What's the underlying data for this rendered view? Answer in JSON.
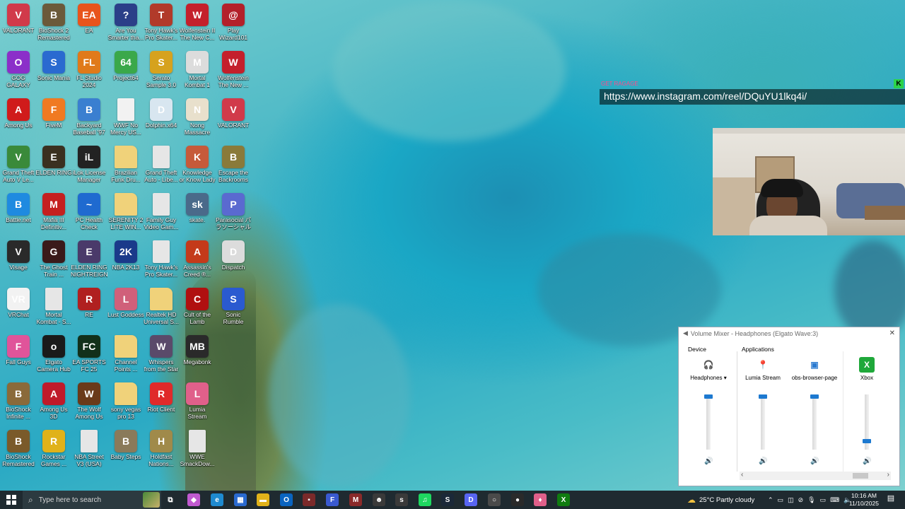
{
  "desktop_icons": [
    {
      "label": "VALORANT",
      "color": "#d13a4a",
      "glyph": "V",
      "icon": "valorant-icon"
    },
    {
      "label": "BioShock 2\nRemastered",
      "color": "#6b5a3a",
      "glyph": "B",
      "icon": "bioshock2-icon"
    },
    {
      "label": "EA",
      "color": "#e8541c",
      "glyph": "EA",
      "icon": "ea-icon"
    },
    {
      "label": "Are You\nSmarter tha...",
      "color": "#2b3f88",
      "glyph": "?",
      "icon": "are-you-smarter-icon"
    },
    {
      "label": "Tony Hawk's\nPro Skater...",
      "color": "#b13a2a",
      "glyph": "T",
      "icon": "tony-hawk-icon"
    },
    {
      "label": "Wolfenstein II\nThe New C...",
      "color": "#c4202c",
      "glyph": "W",
      "icon": "wolfenstein2-icon"
    },
    {
      "label": "Play\nWizard101",
      "color": "#b3202a",
      "glyph": "@",
      "icon": "wizard101-icon"
    },
    {
      "label": "GOG GALAXY",
      "color": "#8b2fc9",
      "glyph": "O",
      "icon": "gog-galaxy-icon"
    },
    {
      "label": "Sonic Mania",
      "color": "#2a6ad0",
      "glyph": "S",
      "icon": "sonic-mania-icon"
    },
    {
      "label": "FL Studio\n2024",
      "color": "#e07a1a",
      "glyph": "FL",
      "icon": "fl-studio-icon"
    },
    {
      "label": "Project64",
      "color": "#3aa84a",
      "glyph": "64",
      "icon": "project64-icon"
    },
    {
      "label": "Serato\nSample 3.0",
      "color": "#d6a21e",
      "glyph": "S",
      "icon": "serato-icon"
    },
    {
      "label": "Mortal\nKombat 1",
      "color": "#dcdcdc",
      "glyph": "M",
      "icon": "mortal-kombat1-icon"
    },
    {
      "label": "Wolfenstein\nThe New ...",
      "color": "#c4202c",
      "glyph": "W",
      "icon": "wolfenstein-icon"
    },
    {
      "label": "Among Us",
      "color": "#d01b1b",
      "glyph": "A",
      "icon": "among-us-icon"
    },
    {
      "label": "FiveM",
      "color": "#f07a22",
      "glyph": "F",
      "icon": "fivem-icon"
    },
    {
      "label": "Backyard\nBaseball '97",
      "color": "#3a7fd0",
      "glyph": "B",
      "icon": "backyard-baseball-icon"
    },
    {
      "label": "WWF No\nMercy US...",
      "color": "#f2f2f2",
      "glyph": "",
      "icon": "file-icon"
    },
    {
      "label": "Dolphin.x64",
      "color": "#d8e6f0",
      "glyph": "D",
      "icon": "dolphin-icon"
    },
    {
      "label": "Nong\nMassacre",
      "color": "#e8e0cc",
      "glyph": "N",
      "icon": "nong-massacre-icon"
    },
    {
      "label": "VALORANT",
      "color": "#d13a4a",
      "glyph": "V",
      "icon": "valorant-icon"
    },
    {
      "label": "Grand Theft\nAuto V Le...",
      "color": "#3a8a3a",
      "glyph": "V",
      "icon": "gta5-icon"
    },
    {
      "label": "ELDEN RING",
      "color": "#3a3020",
      "glyph": "E",
      "icon": "elden-ring-icon"
    },
    {
      "label": "iLok License\nManager",
      "color": "#222222",
      "glyph": "iL",
      "icon": "ilok-icon"
    },
    {
      "label": "Brazilian\nFunk Dru...",
      "color": "#f0d27a",
      "glyph": "",
      "icon": "folder-icon"
    },
    {
      "label": "Grand Theft\nAuto - Libe...",
      "color": "#e6e6e6",
      "glyph": "",
      "icon": "file-icon"
    },
    {
      "label": "Knowledge\nor Know Lady",
      "color": "#c65a3a",
      "glyph": "K",
      "icon": "knowledge-icon"
    },
    {
      "label": "Escape the\nBackrooms",
      "color": "#8a7a3a",
      "glyph": "B",
      "icon": "backrooms-icon"
    },
    {
      "label": "Battle.net",
      "color": "#1f8ae0",
      "glyph": "B",
      "icon": "battlenet-icon"
    },
    {
      "label": "Mafia III\nDefinitiv...",
      "color": "#c42020",
      "glyph": "M",
      "icon": "mafia3-icon"
    },
    {
      "label": "PC Health\nCheck",
      "color": "#1f6ad0",
      "glyph": "~",
      "icon": "pc-health-icon"
    },
    {
      "label": "SERENITY 2\nLITE WIN...",
      "color": "#f0d27a",
      "glyph": "",
      "icon": "folder-icon"
    },
    {
      "label": "Family Guy\nVideo Gam...",
      "color": "#e6e6e6",
      "glyph": "",
      "icon": "file-icon"
    },
    {
      "label": "skate.",
      "color": "#4a6a8a",
      "glyph": "sk",
      "icon": "skate-icon"
    },
    {
      "label": "Parasocial パ\nラソーシャル",
      "color": "#5a6ad0",
      "glyph": "P",
      "icon": "parasocial-icon"
    },
    {
      "label": "Visage",
      "color": "#2a2a2a",
      "glyph": "V",
      "icon": "visage-icon"
    },
    {
      "label": "The Ghost\nTrain ...",
      "color": "#3a1a1a",
      "glyph": "G",
      "icon": "ghost-train-icon"
    },
    {
      "label": "ELDEN RING\nNIGHTREIGN",
      "color": "#4a3a6a",
      "glyph": "E",
      "icon": "nightreign-icon"
    },
    {
      "label": "NBA 2K13",
      "color": "#1a3a8a",
      "glyph": "2K",
      "icon": "nba2k13-icon"
    },
    {
      "label": "Tony Hawk's\nPro Skater...",
      "color": "#e6e6e6",
      "glyph": "",
      "icon": "file-icon"
    },
    {
      "label": "Assassin's\nCreed ®...",
      "color": "#c43a1a",
      "glyph": "A",
      "icon": "assassins-creed-icon"
    },
    {
      "label": "Dispatch",
      "color": "#dcdcdc",
      "glyph": "D",
      "icon": "dispatch-icon"
    },
    {
      "label": "VRChat",
      "color": "#f2f2f2",
      "glyph": "VR",
      "icon": "vrchat-icon"
    },
    {
      "label": "Mortal\nKombat - S...",
      "color": "#e6e6e6",
      "glyph": "",
      "icon": "file-icon"
    },
    {
      "label": "RE",
      "color": "#b02020",
      "glyph": "R",
      "icon": "re-icon"
    },
    {
      "label": "Lust Goddess",
      "color": "#d0607a",
      "glyph": "L",
      "icon": "lust-goddess-icon"
    },
    {
      "label": "Realtek HD\nUniversal S...",
      "color": "#f0d27a",
      "glyph": "",
      "icon": "folder-icon"
    },
    {
      "label": "Cult of the\nLamb",
      "color": "#b01010",
      "glyph": "C",
      "icon": "cult-of-lamb-icon"
    },
    {
      "label": "Sonic\nRumble",
      "color": "#2a5ad0",
      "glyph": "S",
      "icon": "sonic-rumble-icon"
    },
    {
      "label": "Fall Guys",
      "color": "#e0549a",
      "glyph": "F",
      "icon": "fall-guys-icon"
    },
    {
      "label": "Elgato\nCamera Hub",
      "color": "#1a1a1a",
      "glyph": "o",
      "icon": "elgato-icon"
    },
    {
      "label": "EA SPORTS\nFC 25",
      "color": "#12301a",
      "glyph": "FC",
      "icon": "ea-fc25-icon"
    },
    {
      "label": "Channel\nPoints ...",
      "color": "#f0d27a",
      "glyph": "",
      "icon": "folder-icon"
    },
    {
      "label": "Whispers\nfrom the Star",
      "color": "#5a4a6a",
      "glyph": "W",
      "icon": "whispers-icon"
    },
    {
      "label": "Megabonk",
      "color": "#2a2a2a",
      "glyph": "MB",
      "icon": "megabonk-icon"
    },
    {
      "label": "",
      "color": "rgba(0,0,0,0)",
      "glyph": "",
      "icon": "empty-slot"
    },
    {
      "label": "BioShock\nInfinite ...",
      "color": "#8a6a3a",
      "glyph": "B",
      "icon": "bioshock-infinite-icon"
    },
    {
      "label": "Among Us\n3D",
      "color": "#c01a2a",
      "glyph": "A",
      "icon": "among-us-3d-icon"
    },
    {
      "label": "The Wolf\nAmong Us",
      "color": "#6a3a1a",
      "glyph": "W",
      "icon": "wolf-among-us-icon"
    },
    {
      "label": "sony vegas\npro 13",
      "color": "#f0d27a",
      "glyph": "",
      "icon": "folder-icon"
    },
    {
      "label": "Riot Client",
      "color": "#e02a2a",
      "glyph": "R",
      "icon": "riot-client-icon"
    },
    {
      "label": "Lumia\nStream",
      "color": "#e0608a",
      "glyph": "L",
      "icon": "lumia-stream-icon"
    },
    {
      "label": "",
      "color": "rgba(0,0,0,0)",
      "glyph": "",
      "icon": "empty-slot"
    },
    {
      "label": "BioShock\nRemastered",
      "color": "#7a5a2a",
      "glyph": "B",
      "icon": "bioshock-remastered-icon"
    },
    {
      "label": "Rockstar\nGames ...",
      "color": "#e0b21a",
      "glyph": "R",
      "icon": "rockstar-icon"
    },
    {
      "label": "NBA Street\nV3 (USA)",
      "color": "#e6e6e6",
      "glyph": "",
      "icon": "file-icon"
    },
    {
      "label": "Baby Steps",
      "color": "#8a7a5a",
      "glyph": "B",
      "icon": "baby-steps-icon"
    },
    {
      "label": "Holdfast\nNations...",
      "color": "#a08a4a",
      "glyph": "H",
      "icon": "holdfast-icon"
    },
    {
      "label": "WWE\nSmackDow...",
      "color": "#e6e6e6",
      "glyph": "",
      "icon": "file-icon"
    },
    {
      "label": "",
      "color": "rgba(0,0,0,0)",
      "glyph": "",
      "icon": "empty-slot"
    }
  ],
  "overlay": {
    "tag": "GET RAGAGE",
    "url": "https://www.instagram.com/reel/DQuYU1lkq4i/",
    "badge": "K"
  },
  "mixer": {
    "title": "Volume Mixer - Headphones (Elgato Wave:3)",
    "close": "✕",
    "device_heading": "Device",
    "apps_heading": "Applications",
    "channels": [
      {
        "name": "Headphones ▾",
        "icon": "headphones-icon",
        "level": 1.0,
        "glyph": "🎧"
      },
      {
        "name": "Lumia Stream",
        "icon": "lumia-stream-icon",
        "level": 1.0,
        "glyph": "📍"
      },
      {
        "name": "obs-browser-page",
        "icon": "obs-browser-icon",
        "level": 1.0,
        "glyph": "▣"
      },
      {
        "name": "Xbox",
        "icon": "xbox-icon",
        "level": 0.15,
        "glyph": "X"
      }
    ],
    "speaker_glyph": "🔊",
    "scroll_left": "‹",
    "scroll_right": "›"
  },
  "taskbar": {
    "search_placeholder": "Type here to search",
    "weather": "25°C  Partly cloudy",
    "time": "10:16 AM",
    "date": "11/10/2025",
    "apps": [
      {
        "icon": "task-view-icon",
        "glyph": "⧉",
        "color": "rgba(0,0,0,0)"
      },
      {
        "icon": "copilot-icon",
        "glyph": "◆",
        "color": "#c05ad0"
      },
      {
        "icon": "edge-icon",
        "glyph": "e",
        "color": "#1e8ad0"
      },
      {
        "icon": "store-icon",
        "glyph": "▦",
        "color": "#2a6ad0"
      },
      {
        "icon": "file-explorer-icon",
        "glyph": "▬",
        "color": "#e0b21a"
      },
      {
        "icon": "outlook-icon",
        "glyph": "O",
        "color": "#0a64c0"
      },
      {
        "icon": "app-icon",
        "glyph": "▪",
        "color": "#7a2a2a"
      },
      {
        "icon": "fall-guys-icon",
        "glyph": "F",
        "color": "#3a5ad0"
      },
      {
        "icon": "megabonk-icon",
        "glyph": "M",
        "color": "#8a2a2a"
      },
      {
        "icon": "person-app-icon",
        "glyph": "☻",
        "color": "#3a3a3a"
      },
      {
        "icon": "skate-icon",
        "glyph": "s",
        "color": "#3a3a3a"
      },
      {
        "icon": "spotify-icon",
        "glyph": "♫",
        "color": "#1ed760"
      },
      {
        "icon": "steam-icon",
        "glyph": "S",
        "color": "#1b2838"
      },
      {
        "icon": "discord-icon",
        "glyph": "D",
        "color": "#5865f2"
      },
      {
        "icon": "obs-icon",
        "glyph": "○",
        "color": "#4a4a4a"
      },
      {
        "icon": "obs-studio-icon",
        "glyph": "●",
        "color": "#2a2a2a"
      },
      {
        "icon": "lumia-stream-icon",
        "glyph": "♦",
        "color": "#e0608a"
      },
      {
        "icon": "xbox-icon",
        "glyph": "X",
        "color": "#107c10"
      }
    ]
  }
}
